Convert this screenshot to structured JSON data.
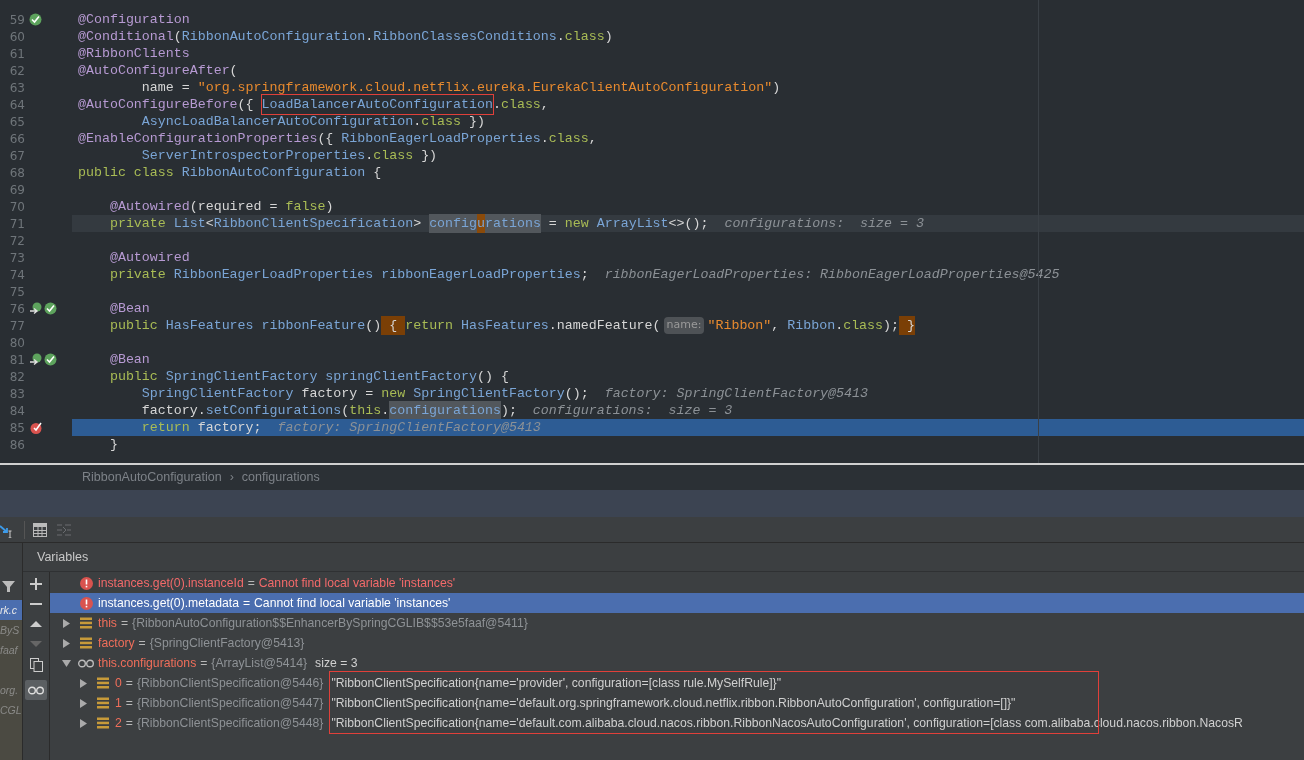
{
  "editor": {
    "lines": [
      {
        "number": "59",
        "kind": "plain",
        "gutter": [
          {
            "kind": "bean"
          }
        ],
        "tokens": [
          {
            "t": "@Configuration",
            "kind": "ann"
          }
        ]
      },
      {
        "number": "60",
        "kind": "plain",
        "tokens": [
          {
            "t": "@Conditional",
            "kind": "ann"
          },
          {
            "t": "(",
            "kind": "plain"
          },
          {
            "t": "RibbonAutoConfiguration",
            "kind": "type"
          },
          {
            "t": ".",
            "kind": "plain"
          },
          {
            "t": "RibbonClassesConditions",
            "kind": "type"
          },
          {
            "t": ".",
            "kind": "plain"
          },
          {
            "t": "class",
            "kind": "kw"
          },
          {
            "t": ")",
            "kind": "plain"
          }
        ]
      },
      {
        "number": "61",
        "kind": "plain",
        "tokens": [
          {
            "t": "@RibbonClients",
            "kind": "ann"
          }
        ]
      },
      {
        "number": "62",
        "kind": "plain",
        "tokens": [
          {
            "t": "@AutoConfigureAfter",
            "kind": "ann"
          },
          {
            "t": "(",
            "kind": "plain"
          }
        ]
      },
      {
        "number": "63",
        "kind": "plain",
        "tokens": [
          {
            "t": "        name = ",
            "kind": "plain"
          },
          {
            "t": "\"org.springframework.cloud.netflix.eureka.EurekaClientAutoConfiguration\"",
            "kind": "str"
          },
          {
            "t": ")",
            "kind": "plain"
          }
        ]
      },
      {
        "number": "64",
        "kind": "plain",
        "tokens": [
          {
            "t": "@AutoConfigureBefore",
            "kind": "ann"
          },
          {
            "t": "({ ",
            "kind": "plain"
          },
          {
            "t": "LoadBalancerAutoConfiguration",
            "kind": "boxed"
          },
          {
            "t": ".",
            "kind": "plain"
          },
          {
            "t": "class",
            "kind": "kw"
          },
          {
            "t": ",",
            "kind": "plain"
          }
        ]
      },
      {
        "number": "65",
        "kind": "plain",
        "tokens": [
          {
            "t": "        AsyncLoadBalancerAutoConfiguration",
            "kind": "type"
          },
          {
            "t": ".",
            "kind": "plain"
          },
          {
            "t": "class",
            "kind": "kw"
          },
          {
            "t": " })",
            "kind": "plain"
          }
        ]
      },
      {
        "number": "66",
        "kind": "plain",
        "tokens": [
          {
            "t": "@EnableConfigurationProperties",
            "kind": "ann"
          },
          {
            "t": "({ ",
            "kind": "plain"
          },
          {
            "t": "RibbonEagerLoadProperties",
            "kind": "type"
          },
          {
            "t": ".",
            "kind": "plain"
          },
          {
            "t": "class",
            "kind": "kw"
          },
          {
            "t": ",",
            "kind": "plain"
          }
        ]
      },
      {
        "number": "67",
        "kind": "plain",
        "tokens": [
          {
            "t": "        ServerIntrospectorProperties",
            "kind": "type"
          },
          {
            "t": ".",
            "kind": "plain"
          },
          {
            "t": "class",
            "kind": "kw"
          },
          {
            "t": " })",
            "kind": "plain"
          }
        ]
      },
      {
        "number": "68",
        "kind": "plain",
        "tokens": [
          {
            "t": "public class ",
            "kind": "kw"
          },
          {
            "t": "RibbonAutoConfiguration",
            "kind": "type"
          },
          {
            "t": " {",
            "kind": "plain"
          }
        ]
      },
      {
        "number": "69",
        "kind": "plain"
      },
      {
        "number": "70",
        "kind": "plain",
        "tokens": [
          {
            "t": "    @Autowired",
            "kind": "ann"
          },
          {
            "t": "(required = ",
            "kind": "plain"
          },
          {
            "t": "false",
            "kind": "kw"
          },
          {
            "t": ")",
            "kind": "plain"
          }
        ]
      },
      {
        "number": "71",
        "kind": "caret",
        "tokens": [
          {
            "t": "    private ",
            "kind": "kw"
          },
          {
            "t": "List",
            "kind": "type"
          },
          {
            "t": "<",
            "kind": "plain"
          },
          {
            "t": "RibbonClientSpecification",
            "kind": "type"
          },
          {
            "t": "> ",
            "kind": "plain"
          },
          {
            "t": "config",
            "kind": "usage"
          },
          {
            "t": "u",
            "kind": "caret"
          },
          {
            "t": "rations",
            "kind": "usage"
          },
          {
            "t": " = ",
            "kind": "plain"
          },
          {
            "t": "new ",
            "kind": "kw"
          },
          {
            "t": "ArrayList",
            "kind": "type"
          },
          {
            "t": "<>();",
            "kind": "plain"
          },
          {
            "t": "  configurations:  size = 3",
            "kind": "hint"
          }
        ]
      },
      {
        "number": "72",
        "kind": "plain"
      },
      {
        "number": "73",
        "kind": "plain",
        "tokens": [
          {
            "t": "    @Autowired",
            "kind": "ann"
          }
        ]
      },
      {
        "number": "74",
        "kind": "plain",
        "tokens": [
          {
            "t": "    private ",
            "kind": "kw"
          },
          {
            "t": "RibbonEagerLoadProperties ribbonEagerLoadProperties",
            "kind": "type"
          },
          {
            "t": ";",
            "kind": "plain"
          },
          {
            "t": "  ribbonEagerLoadProperties: RibbonEagerLoadProperties@5425",
            "kind": "hint"
          }
        ]
      },
      {
        "number": "75",
        "kind": "plain"
      },
      {
        "number": "76",
        "kind": "plain",
        "gutter": [
          {
            "kind": "override"
          },
          {
            "kind": "bean"
          }
        ],
        "tokens": [
          {
            "t": "    @Bean",
            "kind": "ann"
          }
        ]
      },
      {
        "number": "77",
        "kind": "plain",
        "tokens": [
          {
            "t": "    public ",
            "kind": "kw"
          },
          {
            "t": "HasFeatures ribbonFeature",
            "kind": "type"
          },
          {
            "t": "()",
            "kind": "plain"
          },
          {
            "t": " { ",
            "kind": "brace"
          },
          {
            "t": "return ",
            "kind": "kw"
          },
          {
            "t": "HasFeatures",
            "kind": "type"
          },
          {
            "t": ".namedFeature(",
            "kind": "plain"
          },
          {
            "t": "name:",
            "kind": "param"
          },
          {
            "t": "\"Ribbon\"",
            "kind": "str"
          },
          {
            "t": ", ",
            "kind": "plain"
          },
          {
            "t": "Ribbon",
            "kind": "type"
          },
          {
            "t": ".",
            "kind": "plain"
          },
          {
            "t": "class",
            "kind": "kw"
          },
          {
            "t": ");",
            "kind": "plain"
          },
          {
            "t": " }",
            "kind": "brace"
          }
        ]
      },
      {
        "number": "80",
        "kind": "plain"
      },
      {
        "number": "81",
        "kind": "plain",
        "gutter": [
          {
            "kind": "override"
          },
          {
            "kind": "bean"
          }
        ],
        "tokens": [
          {
            "t": "    @Bean",
            "kind": "ann"
          }
        ]
      },
      {
        "number": "82",
        "kind": "plain",
        "tokens": [
          {
            "t": "    public ",
            "kind": "kw"
          },
          {
            "t": "SpringClientFactory springClientFactory",
            "kind": "type"
          },
          {
            "t": "() {",
            "kind": "plain"
          }
        ]
      },
      {
        "number": "83",
        "kind": "plain",
        "tokens": [
          {
            "t": "        SpringClientFactory",
            "kind": "type"
          },
          {
            "t": " factory = ",
            "kind": "plain"
          },
          {
            "t": "new ",
            "kind": "kw"
          },
          {
            "t": "SpringClientFactory",
            "kind": "type"
          },
          {
            "t": "();",
            "kind": "plain"
          },
          {
            "t": "  factory: SpringClientFactory@5413",
            "kind": "hint"
          }
        ]
      },
      {
        "number": "84",
        "kind": "plain",
        "tokens": [
          {
            "t": "        factory.",
            "kind": "plain"
          },
          {
            "t": "setConfigurations",
            "kind": "type"
          },
          {
            "t": "(",
            "kind": "plain"
          },
          {
            "t": "this",
            "kind": "kw"
          },
          {
            "t": ".",
            "kind": "plain"
          },
          {
            "t": "configurations",
            "kind": "usage"
          },
          {
            "t": ");",
            "kind": "plain"
          },
          {
            "t": "  configurations:  size = 3",
            "kind": "hint"
          }
        ]
      },
      {
        "number": "85",
        "kind": "execution",
        "gutter": [
          {
            "kind": "breakpoint"
          }
        ],
        "tokens": [
          {
            "t": "        return ",
            "kind": "kw"
          },
          {
            "t": "factory;",
            "kind": "plain"
          },
          {
            "t": "  factory: SpringClientFactory@5413",
            "kind": "hint"
          }
        ]
      },
      {
        "number": "86",
        "kind": "plain",
        "tokens": [
          {
            "t": "    }",
            "kind": "plain"
          }
        ]
      }
    ]
  },
  "breadcrumbs": [
    "RibbonAutoConfiguration",
    "configurations"
  ],
  "breadcrumb_separator": "›",
  "frames": [
    {
      "text": "rk.c",
      "selected": true
    },
    {
      "text": "ByS",
      "selected": false
    },
    {
      "text": "faaf",
      "selected": false
    },
    {
      "text": "org.",
      "selected": false
    },
    {
      "text": "CGL",
      "selected": false
    }
  ],
  "variables": {
    "title": "Variables",
    "rows": [
      {
        "kind": "error",
        "name": "instances.get(0).instanceId",
        "operator": "=",
        "value": "Cannot find local variable 'instances'",
        "selected": false
      },
      {
        "kind": "error",
        "name": "instances.get(0).metadata",
        "operator": "=",
        "value": "Cannot find local variable 'instances'",
        "selected": true
      },
      {
        "kind": "field",
        "name": "this",
        "operator": "=",
        "value": "{RibbonAutoConfiguration$$EnhancerBySpringCGLIB$$53e5faaf@5411}",
        "selected": false,
        "expanded": false
      },
      {
        "kind": "field",
        "name": "factory",
        "operator": "=",
        "value": "{SpringClientFactory@5413}",
        "selected": false,
        "expanded": false
      },
      {
        "kind": "watch",
        "name": "this.configurations",
        "operator": "=",
        "value": "{ArrayList@5414}",
        "note": "size = 3",
        "selected": false,
        "expanded": true,
        "outlined_children": true,
        "children": [
          {
            "kind": "field",
            "name": "0",
            "operator": "=",
            "value": "{RibbonClientSpecification@5446}",
            "note": "\"RibbonClientSpecification{name='provider', configuration=[class rule.MySelfRule]}\"",
            "selected": false,
            "expanded": false
          },
          {
            "kind": "field",
            "name": "1",
            "operator": "=",
            "value": "{RibbonClientSpecification@5447}",
            "note": "\"RibbonClientSpecification{name='default.org.springframework.cloud.netflix.ribbon.RibbonAutoConfiguration', configuration=[]}\"",
            "selected": false,
            "expanded": false
          },
          {
            "kind": "field",
            "name": "2",
            "operator": "=",
            "value": "{RibbonClientSpecification@5448}",
            "note": "\"RibbonClientSpecification{name='default.com.alibaba.cloud.nacos.ribbon.RibbonNacosAutoConfiguration', configuration=[class com.alibaba.cloud.nacos.ribbon.NacosR",
            "selected": false,
            "expanded": false
          }
        ]
      }
    ]
  }
}
